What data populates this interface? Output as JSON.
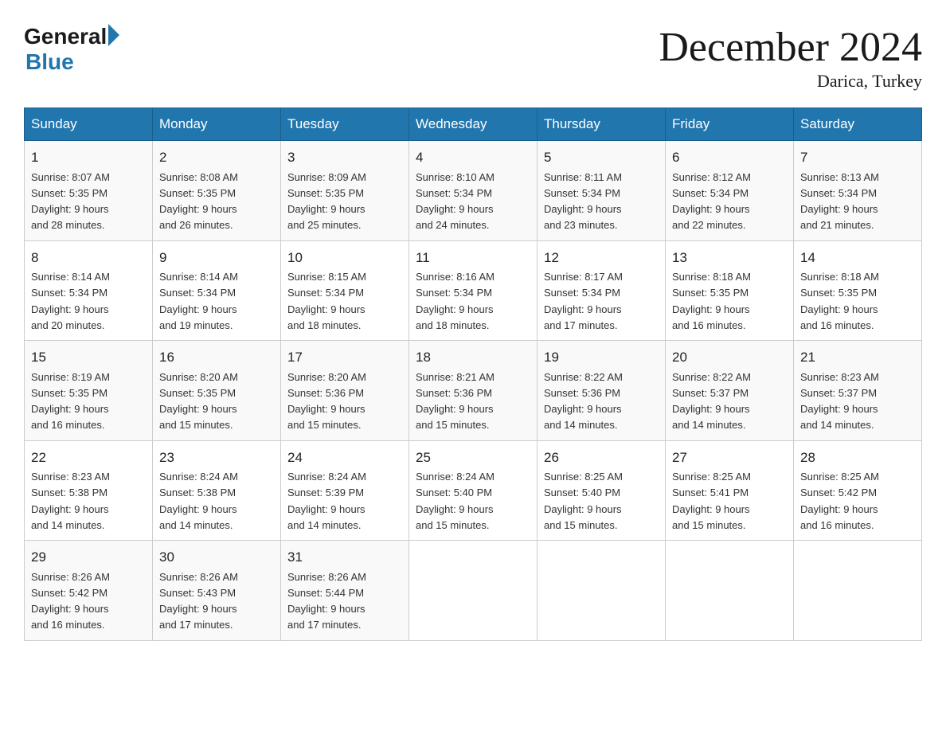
{
  "logo": {
    "general": "General",
    "blue": "Blue"
  },
  "title": "December 2024",
  "location": "Darica, Turkey",
  "days_header": [
    "Sunday",
    "Monday",
    "Tuesday",
    "Wednesday",
    "Thursday",
    "Friday",
    "Saturday"
  ],
  "weeks": [
    [
      {
        "day": "1",
        "sunrise": "8:07 AM",
        "sunset": "5:35 PM",
        "daylight": "9 hours and 28 minutes."
      },
      {
        "day": "2",
        "sunrise": "8:08 AM",
        "sunset": "5:35 PM",
        "daylight": "9 hours and 26 minutes."
      },
      {
        "day": "3",
        "sunrise": "8:09 AM",
        "sunset": "5:35 PM",
        "daylight": "9 hours and 25 minutes."
      },
      {
        "day": "4",
        "sunrise": "8:10 AM",
        "sunset": "5:34 PM",
        "daylight": "9 hours and 24 minutes."
      },
      {
        "day": "5",
        "sunrise": "8:11 AM",
        "sunset": "5:34 PM",
        "daylight": "9 hours and 23 minutes."
      },
      {
        "day": "6",
        "sunrise": "8:12 AM",
        "sunset": "5:34 PM",
        "daylight": "9 hours and 22 minutes."
      },
      {
        "day": "7",
        "sunrise": "8:13 AM",
        "sunset": "5:34 PM",
        "daylight": "9 hours and 21 minutes."
      }
    ],
    [
      {
        "day": "8",
        "sunrise": "8:14 AM",
        "sunset": "5:34 PM",
        "daylight": "9 hours and 20 minutes."
      },
      {
        "day": "9",
        "sunrise": "8:14 AM",
        "sunset": "5:34 PM",
        "daylight": "9 hours and 19 minutes."
      },
      {
        "day": "10",
        "sunrise": "8:15 AM",
        "sunset": "5:34 PM",
        "daylight": "9 hours and 18 minutes."
      },
      {
        "day": "11",
        "sunrise": "8:16 AM",
        "sunset": "5:34 PM",
        "daylight": "9 hours and 18 minutes."
      },
      {
        "day": "12",
        "sunrise": "8:17 AM",
        "sunset": "5:34 PM",
        "daylight": "9 hours and 17 minutes."
      },
      {
        "day": "13",
        "sunrise": "8:18 AM",
        "sunset": "5:35 PM",
        "daylight": "9 hours and 16 minutes."
      },
      {
        "day": "14",
        "sunrise": "8:18 AM",
        "sunset": "5:35 PM",
        "daylight": "9 hours and 16 minutes."
      }
    ],
    [
      {
        "day": "15",
        "sunrise": "8:19 AM",
        "sunset": "5:35 PM",
        "daylight": "9 hours and 16 minutes."
      },
      {
        "day": "16",
        "sunrise": "8:20 AM",
        "sunset": "5:35 PM",
        "daylight": "9 hours and 15 minutes."
      },
      {
        "day": "17",
        "sunrise": "8:20 AM",
        "sunset": "5:36 PM",
        "daylight": "9 hours and 15 minutes."
      },
      {
        "day": "18",
        "sunrise": "8:21 AM",
        "sunset": "5:36 PM",
        "daylight": "9 hours and 15 minutes."
      },
      {
        "day": "19",
        "sunrise": "8:22 AM",
        "sunset": "5:36 PM",
        "daylight": "9 hours and 14 minutes."
      },
      {
        "day": "20",
        "sunrise": "8:22 AM",
        "sunset": "5:37 PM",
        "daylight": "9 hours and 14 minutes."
      },
      {
        "day": "21",
        "sunrise": "8:23 AM",
        "sunset": "5:37 PM",
        "daylight": "9 hours and 14 minutes."
      }
    ],
    [
      {
        "day": "22",
        "sunrise": "8:23 AM",
        "sunset": "5:38 PM",
        "daylight": "9 hours and 14 minutes."
      },
      {
        "day": "23",
        "sunrise": "8:24 AM",
        "sunset": "5:38 PM",
        "daylight": "9 hours and 14 minutes."
      },
      {
        "day": "24",
        "sunrise": "8:24 AM",
        "sunset": "5:39 PM",
        "daylight": "9 hours and 14 minutes."
      },
      {
        "day": "25",
        "sunrise": "8:24 AM",
        "sunset": "5:40 PM",
        "daylight": "9 hours and 15 minutes."
      },
      {
        "day": "26",
        "sunrise": "8:25 AM",
        "sunset": "5:40 PM",
        "daylight": "9 hours and 15 minutes."
      },
      {
        "day": "27",
        "sunrise": "8:25 AM",
        "sunset": "5:41 PM",
        "daylight": "9 hours and 15 minutes."
      },
      {
        "day": "28",
        "sunrise": "8:25 AM",
        "sunset": "5:42 PM",
        "daylight": "9 hours and 16 minutes."
      }
    ],
    [
      {
        "day": "29",
        "sunrise": "8:26 AM",
        "sunset": "5:42 PM",
        "daylight": "9 hours and 16 minutes."
      },
      {
        "day": "30",
        "sunrise": "8:26 AM",
        "sunset": "5:43 PM",
        "daylight": "9 hours and 17 minutes."
      },
      {
        "day": "31",
        "sunrise": "8:26 AM",
        "sunset": "5:44 PM",
        "daylight": "9 hours and 17 minutes."
      },
      null,
      null,
      null,
      null
    ]
  ]
}
